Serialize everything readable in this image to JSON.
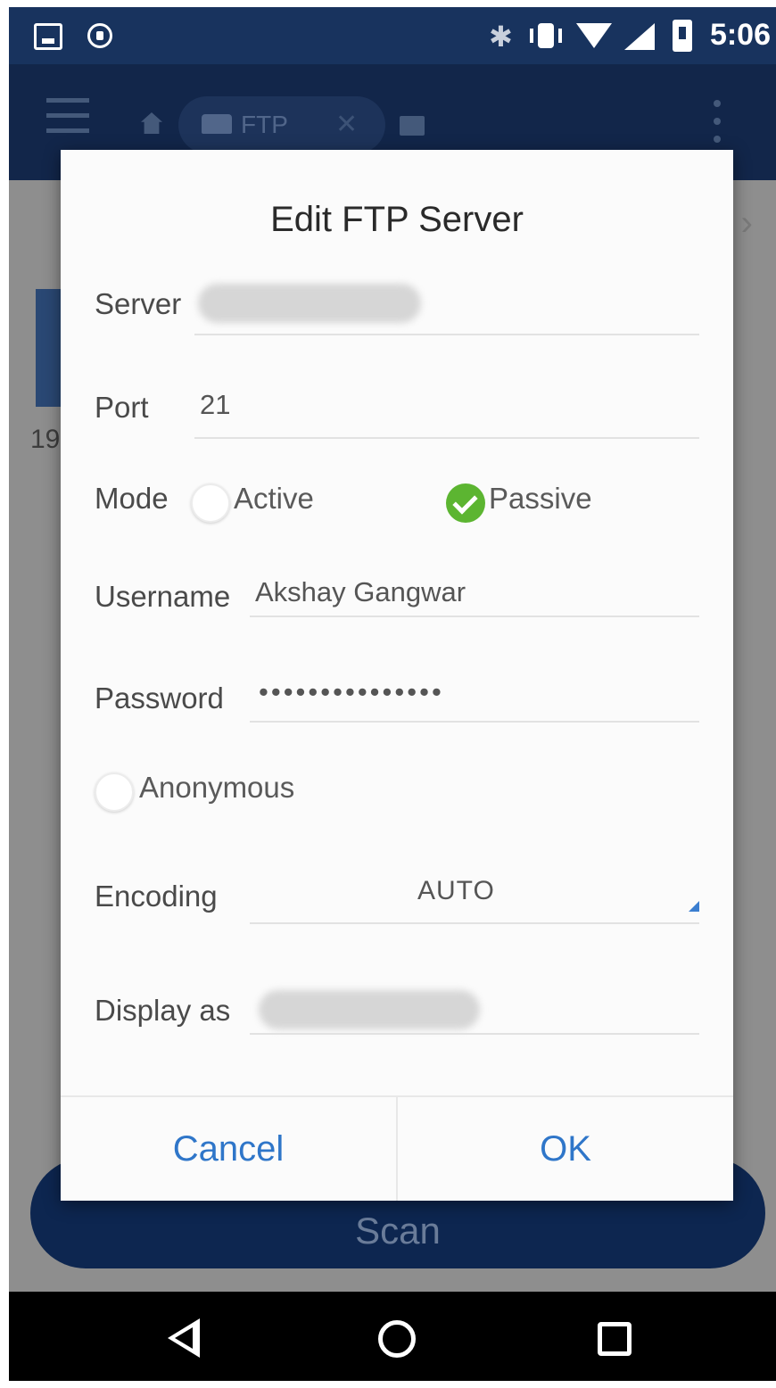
{
  "status_bar": {
    "time": "5:06",
    "icons": [
      "image-icon",
      "shield-icon",
      "bluetooth-icon",
      "vibrate-icon",
      "wifi-icon",
      "signal-icon",
      "battery-icon"
    ]
  },
  "app_bar": {
    "tab_label": "FTP",
    "icons": [
      "menu-icon",
      "home-icon",
      "ftp-drive-icon",
      "close-icon",
      "folder-icon",
      "more-icon"
    ]
  },
  "background": {
    "partial_text": "19",
    "scan_label": "Scan"
  },
  "dialog": {
    "title": "Edit FTP Server",
    "server": {
      "label": "Server",
      "value": ""
    },
    "port": {
      "label": "Port",
      "value": "21"
    },
    "mode": {
      "label": "Mode",
      "options": [
        {
          "label": "Active",
          "selected": false
        },
        {
          "label": "Passive",
          "selected": true
        }
      ]
    },
    "username": {
      "label": "Username",
      "value": "Akshay Gangwar"
    },
    "password": {
      "label": "Password",
      "value": "•••••••••••••••"
    },
    "anonymous": {
      "label": "Anonymous",
      "checked": false
    },
    "encoding": {
      "label": "Encoding",
      "value": "AUTO"
    },
    "display_as": {
      "label": "Display as",
      "value": ""
    },
    "buttons": {
      "cancel": "Cancel",
      "ok": "OK"
    }
  },
  "colors": {
    "app_blue": "#18335e",
    "accent_blue": "#2f76c9",
    "check_green": "#5cb531",
    "scan_button": "#0d2650"
  }
}
